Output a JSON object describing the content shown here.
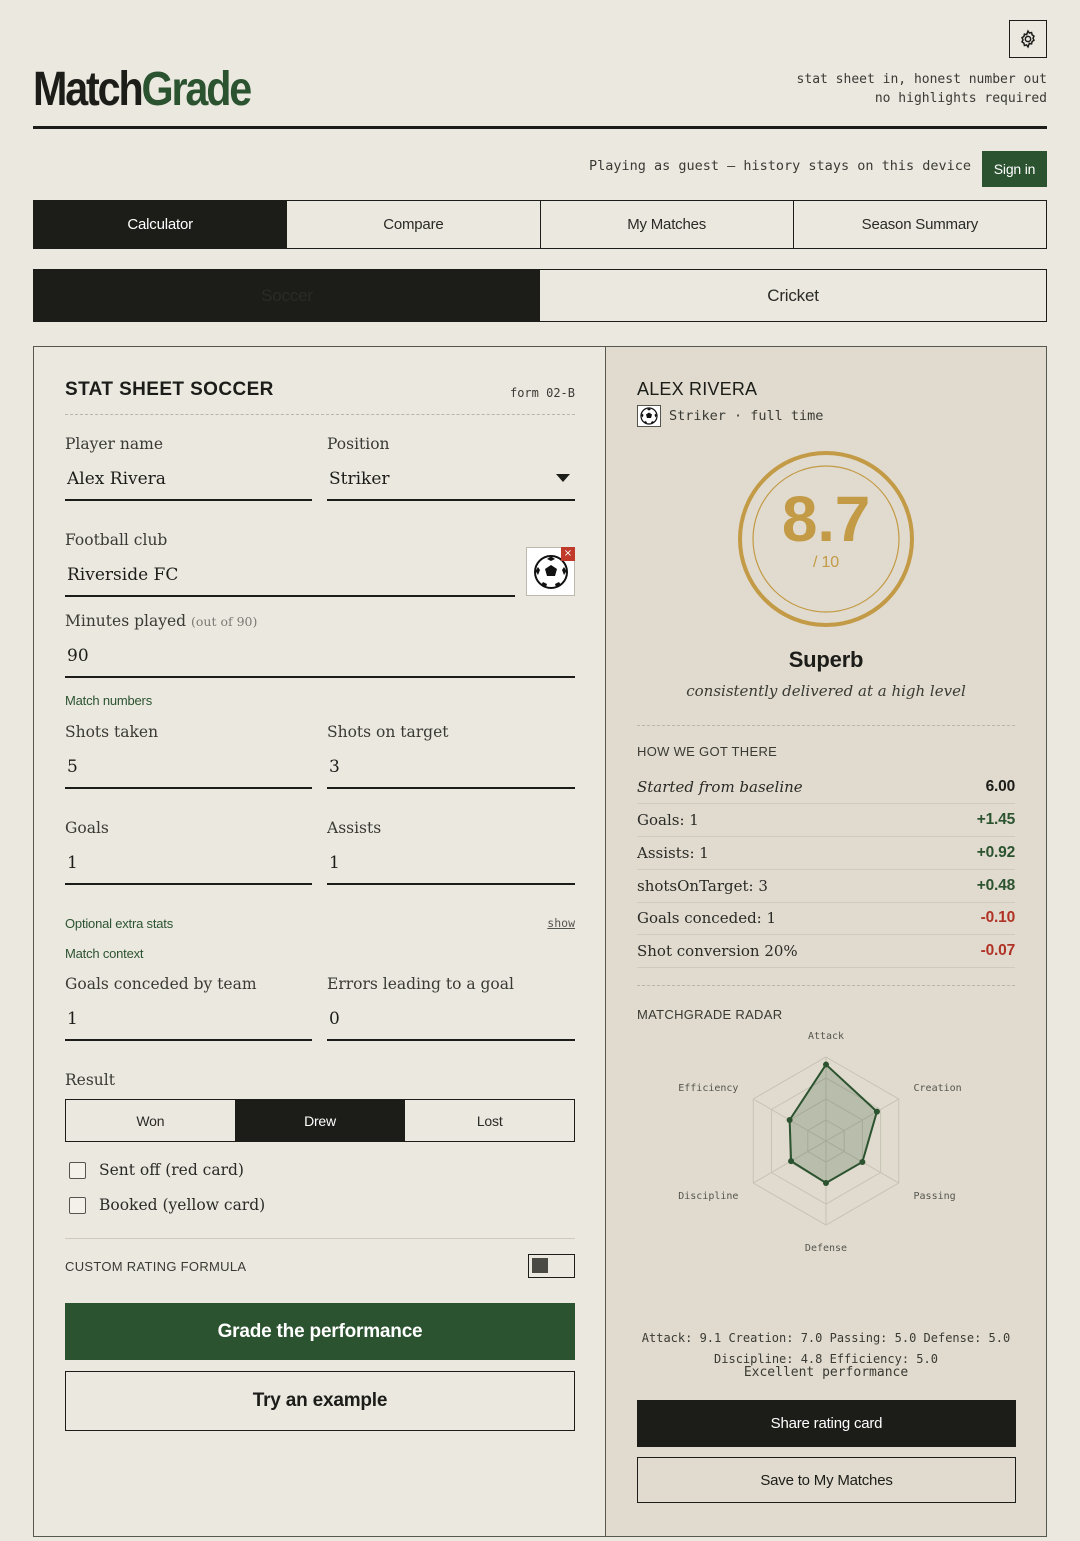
{
  "app": {
    "brand_match": "Match",
    "brand_grade": "Grade",
    "tagline_1": "stat sheet in, honest number out",
    "tagline_2": "no highlights required",
    "guest_note": "Playing as guest — history stays on this device",
    "sign_in": "Sign in"
  },
  "tabs": [
    "Calculator",
    "Compare",
    "My Matches",
    "Season Summary"
  ],
  "sports": [
    "Soccer",
    "Cricket"
  ],
  "form": {
    "title": "STAT SHEET SOCCER",
    "form_id": "form 02-B",
    "player_name_label": "Player name",
    "player_name": "Alex Rivera",
    "position_label": "Position",
    "position": "Striker",
    "club_label": "Football club",
    "club": "Riverside FC",
    "minutes_label": "Minutes played",
    "minutes_hint": "(out of 90)",
    "minutes": "90",
    "match_numbers": "Match numbers",
    "shots_taken_label": "Shots taken",
    "shots_taken": "5",
    "shots_on_target_label": "Shots on target",
    "shots_on_target": "3",
    "goals_label": "Goals",
    "goals": "1",
    "assists_label": "Assists",
    "assists": "1",
    "optional_extra": "Optional extra stats",
    "show": "show",
    "match_context": "Match context",
    "conceded_label": "Goals conceded by team",
    "conceded": "1",
    "errors_label": "Errors leading to a goal",
    "errors": "0",
    "result_label": "Result",
    "results": [
      "Won",
      "Drew",
      "Lost"
    ],
    "sent_off": "Sent off (red card)",
    "booked": "Booked (yellow card)",
    "custom_formula": "CUSTOM RATING FORMULA",
    "grade_btn": "Grade the performance",
    "example_btn": "Try an example"
  },
  "result": {
    "player": "ALEX RIVERA",
    "role": "Striker · full time",
    "score": "8.7",
    "out_of": "/ 10",
    "verdict": "Superb",
    "verdict_sub": "consistently delivered at a high level",
    "how_title": "HOW WE GOT THERE",
    "breakdown": [
      {
        "label": "Started from baseline",
        "value": "6.00"
      },
      {
        "label": "Goals: 1",
        "value": "+1.45"
      },
      {
        "label": "Assists: 1",
        "value": "+0.92"
      },
      {
        "label": "shotsOnTarget: 3",
        "value": "+0.48"
      },
      {
        "label": "Goals conceded: 1",
        "value": "-0.10"
      },
      {
        "label": "Shot conversion 20%",
        "value": "-0.07"
      }
    ],
    "radar_title": "MATCHGRADE RADAR",
    "radar": {
      "axes": [
        "Attack",
        "Creation",
        "Passing",
        "Defense",
        "Discipline",
        "Efficiency"
      ],
      "values": [
        9.1,
        7.0,
        5.0,
        5.0,
        4.8,
        5.0
      ],
      "max": 10
    },
    "radar_line_1": "Attack: 9.1   Creation: 7.0   Passing: 5.0   Defense: 5.0",
    "radar_line_2": "Discipline: 4.8   Efficiency: 5.0",
    "radar_line_3": "Excellent performance",
    "share_btn": "Share rating card",
    "save_btn": "Save to My Matches"
  },
  "colors": {
    "accent": "#2c5330",
    "gold": "#c39a45",
    "negative": "#b03225"
  }
}
